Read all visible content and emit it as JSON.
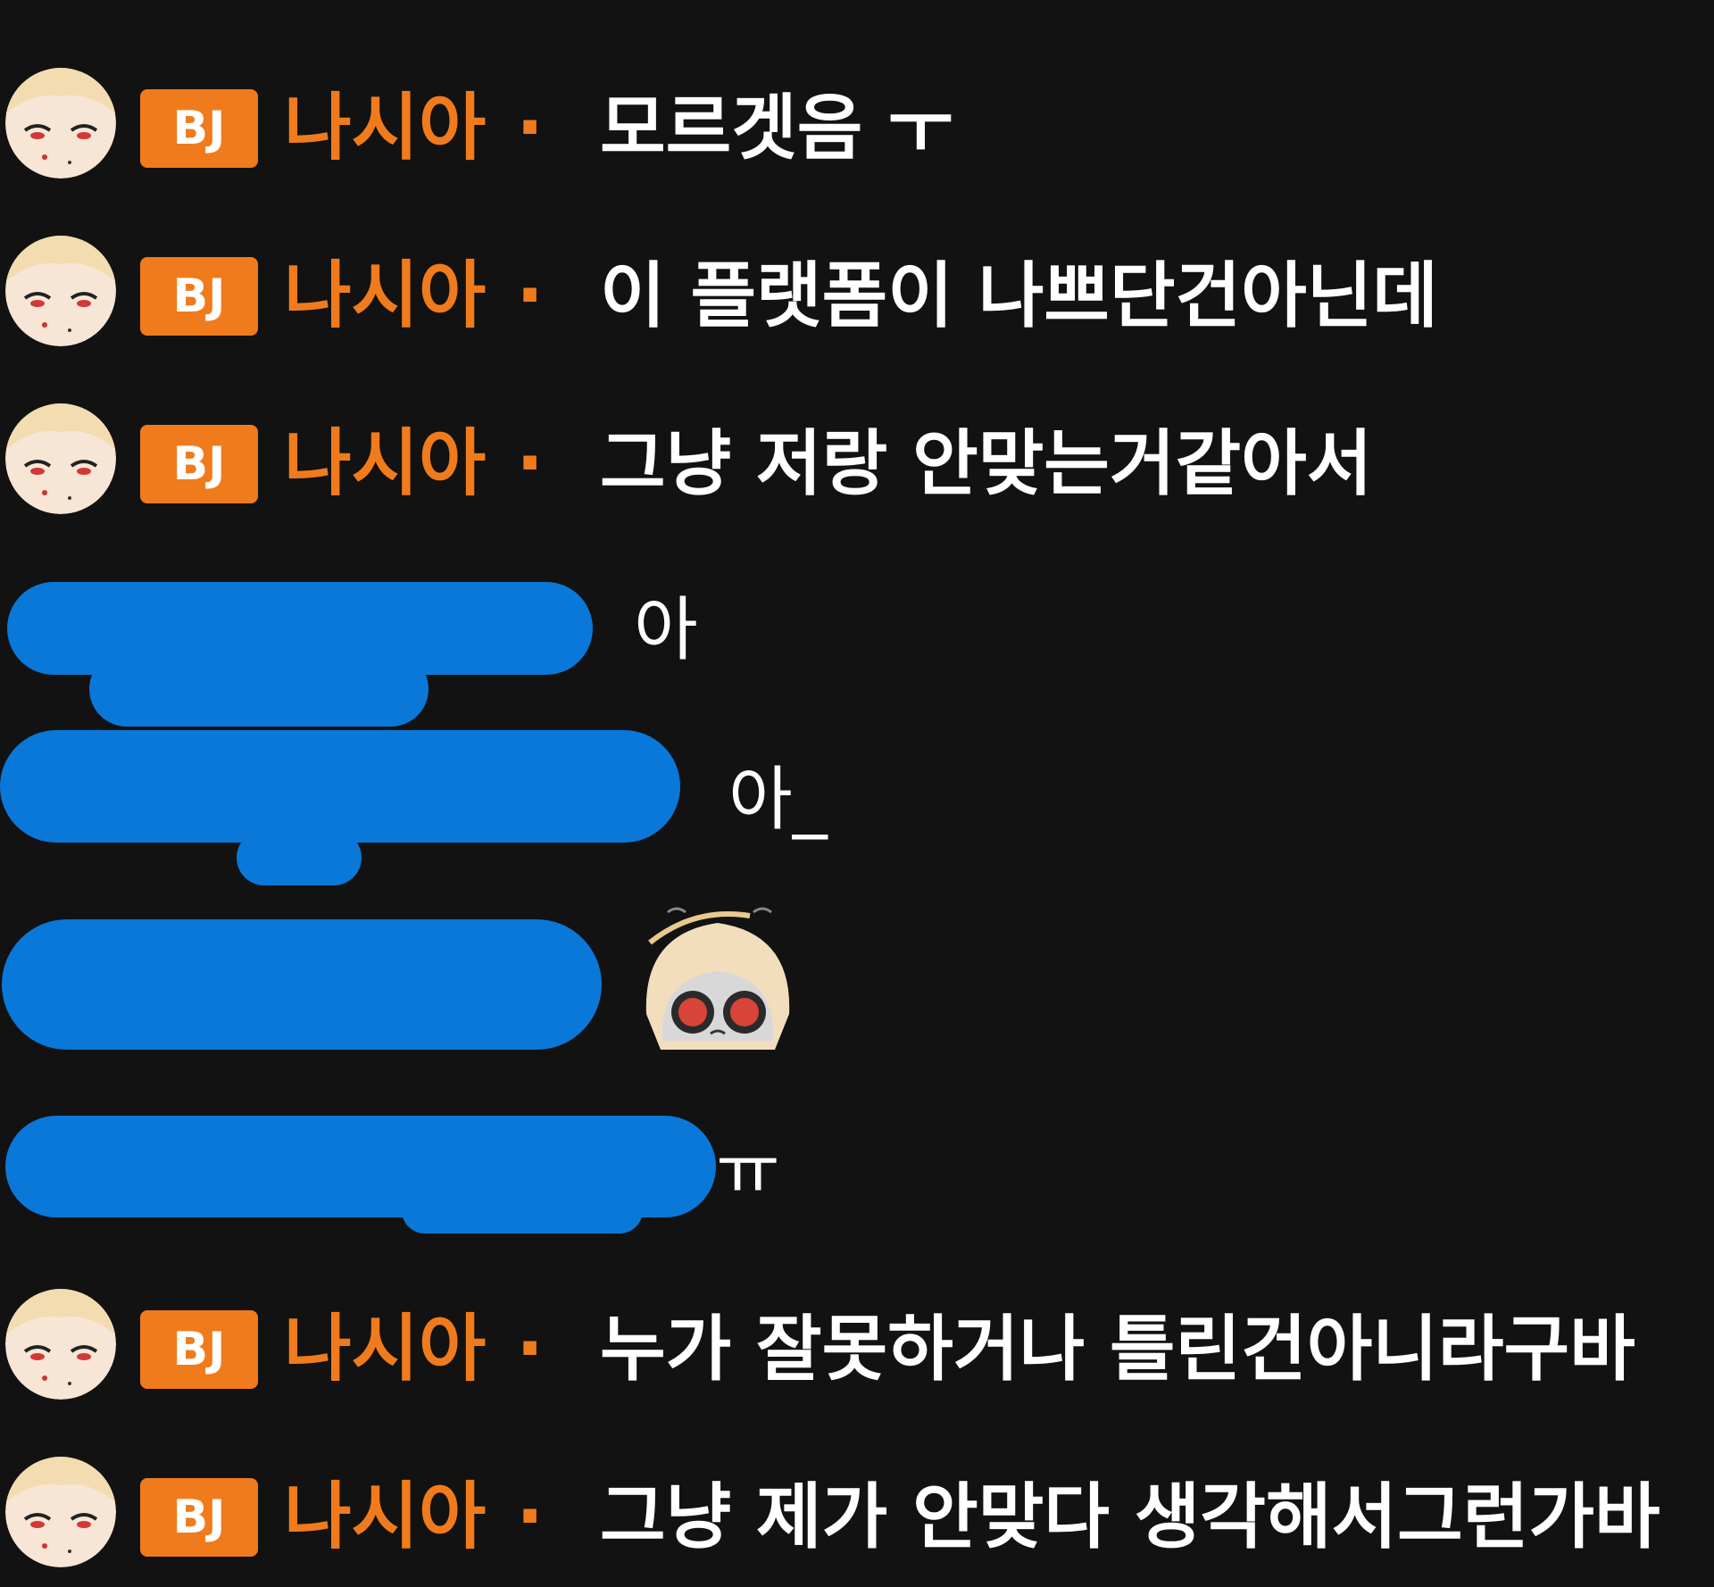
{
  "colors": {
    "background": "#121212",
    "bj_orange": "#f07b1c",
    "redaction_blue": "#0a78d8",
    "text": "#ffffff"
  },
  "messages": [
    {
      "badge": "BJ",
      "nick": "나시아",
      "sep": "·",
      "text": "모르겟음 ㅜ"
    },
    {
      "badge": "BJ",
      "nick": "나시아",
      "sep": "·",
      "text": "이 플랫폼이 나쁘단건아닌데"
    },
    {
      "badge": "BJ",
      "nick": "나시아",
      "sep": "·",
      "text": "그냥 저랑 안맞는거같아서"
    },
    {
      "redacted": true,
      "text": "아"
    },
    {
      "redacted": true,
      "text": "아_"
    },
    {
      "redacted": true,
      "emote": "crying-girl-emote"
    },
    {
      "redacted": true,
      "text": "ㅠ"
    },
    {
      "badge": "BJ",
      "nick": "나시아",
      "sep": "·",
      "text": "누가 잘못하거나 틀린건아니라구바"
    },
    {
      "badge": "BJ",
      "nick": "나시아",
      "sep": "·",
      "text": "그냥 제가 안맞다 생각해서그런가바"
    }
  ]
}
